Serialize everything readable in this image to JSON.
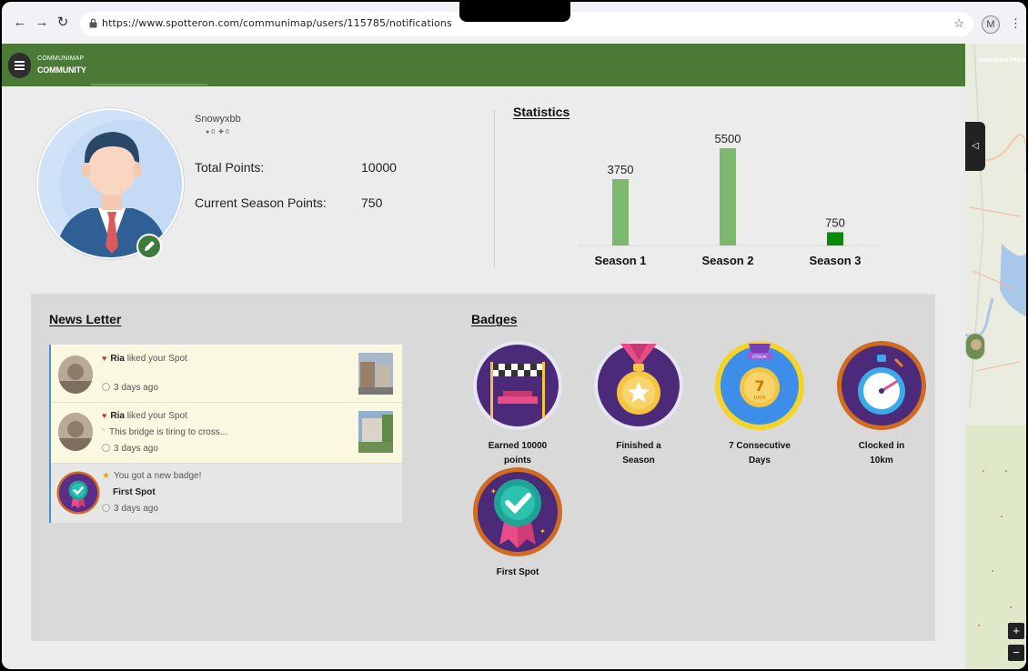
{
  "browser": {
    "url": "https://www.spotteron.com/communimap/users/115785/notifications",
    "profile_initial": "M"
  },
  "app": {
    "brand_top": "COMMUNIMAP",
    "brand_bottom": "COMMUNITY"
  },
  "profile": {
    "username": "Snowyxbb",
    "followers": "0",
    "following": "0",
    "total_points_label": "Total Points:",
    "total_points_value": "10000",
    "season_points_label": "Current Season Points:",
    "season_points_value": "750"
  },
  "statistics": {
    "title": "Statistics"
  },
  "chart_data": {
    "type": "bar",
    "categories": [
      "Season 1",
      "Season 2",
      "Season 3"
    ],
    "values": [
      3750,
      5500,
      750
    ],
    "colors": [
      "#7cb870",
      "#7cb870",
      "#0a8a0a"
    ],
    "ylim": [
      0,
      5500
    ],
    "title": "",
    "xlabel": "",
    "ylabel": ""
  },
  "newsletter": {
    "title": "News Letter",
    "items": [
      {
        "user": "Ria",
        "action": "liked your Spot",
        "comment": "",
        "time": "3 days ago"
      },
      {
        "user": "Ria",
        "action": "liked your Spot",
        "comment": "This bridge is tiring to cross...",
        "time": "3 days ago"
      },
      {
        "headline": "You got a new badge!",
        "badge": "First Spot",
        "time": "3 days ago"
      }
    ]
  },
  "badges": {
    "title": "Badges",
    "items": [
      {
        "line1": "Earned 10000",
        "line2": "points"
      },
      {
        "line1": "Finished a",
        "line2": "Season"
      },
      {
        "line1": "7 Consecutive",
        "line2": "Days",
        "medal_number": "7",
        "medal_label": "DAYS",
        "ribbon_text": "STREAK"
      },
      {
        "line1": "Clocked in",
        "line2": "10km"
      },
      {
        "line1": "First Spot",
        "line2": ""
      }
    ]
  },
  "map": {
    "label": "communiMap"
  }
}
